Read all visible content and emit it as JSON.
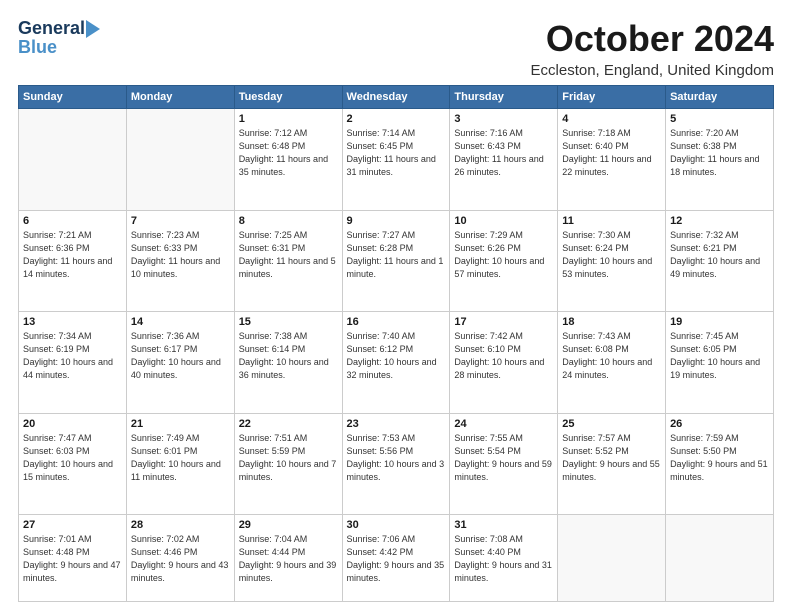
{
  "logo": {
    "line1": "General",
    "line2": "Blue"
  },
  "title": "October 2024",
  "subtitle": "Eccleston, England, United Kingdom",
  "weekdays": [
    "Sunday",
    "Monday",
    "Tuesday",
    "Wednesday",
    "Thursday",
    "Friday",
    "Saturday"
  ],
  "weeks": [
    [
      {
        "day": "",
        "info": ""
      },
      {
        "day": "",
        "info": ""
      },
      {
        "day": "1",
        "info": "Sunrise: 7:12 AM\nSunset: 6:48 PM\nDaylight: 11 hours and 35 minutes."
      },
      {
        "day": "2",
        "info": "Sunrise: 7:14 AM\nSunset: 6:45 PM\nDaylight: 11 hours and 31 minutes."
      },
      {
        "day": "3",
        "info": "Sunrise: 7:16 AM\nSunset: 6:43 PM\nDaylight: 11 hours and 26 minutes."
      },
      {
        "day": "4",
        "info": "Sunrise: 7:18 AM\nSunset: 6:40 PM\nDaylight: 11 hours and 22 minutes."
      },
      {
        "day": "5",
        "info": "Sunrise: 7:20 AM\nSunset: 6:38 PM\nDaylight: 11 hours and 18 minutes."
      }
    ],
    [
      {
        "day": "6",
        "info": "Sunrise: 7:21 AM\nSunset: 6:36 PM\nDaylight: 11 hours and 14 minutes."
      },
      {
        "day": "7",
        "info": "Sunrise: 7:23 AM\nSunset: 6:33 PM\nDaylight: 11 hours and 10 minutes."
      },
      {
        "day": "8",
        "info": "Sunrise: 7:25 AM\nSunset: 6:31 PM\nDaylight: 11 hours and 5 minutes."
      },
      {
        "day": "9",
        "info": "Sunrise: 7:27 AM\nSunset: 6:28 PM\nDaylight: 11 hours and 1 minute."
      },
      {
        "day": "10",
        "info": "Sunrise: 7:29 AM\nSunset: 6:26 PM\nDaylight: 10 hours and 57 minutes."
      },
      {
        "day": "11",
        "info": "Sunrise: 7:30 AM\nSunset: 6:24 PM\nDaylight: 10 hours and 53 minutes."
      },
      {
        "day": "12",
        "info": "Sunrise: 7:32 AM\nSunset: 6:21 PM\nDaylight: 10 hours and 49 minutes."
      }
    ],
    [
      {
        "day": "13",
        "info": "Sunrise: 7:34 AM\nSunset: 6:19 PM\nDaylight: 10 hours and 44 minutes."
      },
      {
        "day": "14",
        "info": "Sunrise: 7:36 AM\nSunset: 6:17 PM\nDaylight: 10 hours and 40 minutes."
      },
      {
        "day": "15",
        "info": "Sunrise: 7:38 AM\nSunset: 6:14 PM\nDaylight: 10 hours and 36 minutes."
      },
      {
        "day": "16",
        "info": "Sunrise: 7:40 AM\nSunset: 6:12 PM\nDaylight: 10 hours and 32 minutes."
      },
      {
        "day": "17",
        "info": "Sunrise: 7:42 AM\nSunset: 6:10 PM\nDaylight: 10 hours and 28 minutes."
      },
      {
        "day": "18",
        "info": "Sunrise: 7:43 AM\nSunset: 6:08 PM\nDaylight: 10 hours and 24 minutes."
      },
      {
        "day": "19",
        "info": "Sunrise: 7:45 AM\nSunset: 6:05 PM\nDaylight: 10 hours and 19 minutes."
      }
    ],
    [
      {
        "day": "20",
        "info": "Sunrise: 7:47 AM\nSunset: 6:03 PM\nDaylight: 10 hours and 15 minutes."
      },
      {
        "day": "21",
        "info": "Sunrise: 7:49 AM\nSunset: 6:01 PM\nDaylight: 10 hours and 11 minutes."
      },
      {
        "day": "22",
        "info": "Sunrise: 7:51 AM\nSunset: 5:59 PM\nDaylight: 10 hours and 7 minutes."
      },
      {
        "day": "23",
        "info": "Sunrise: 7:53 AM\nSunset: 5:56 PM\nDaylight: 10 hours and 3 minutes."
      },
      {
        "day": "24",
        "info": "Sunrise: 7:55 AM\nSunset: 5:54 PM\nDaylight: 9 hours and 59 minutes."
      },
      {
        "day": "25",
        "info": "Sunrise: 7:57 AM\nSunset: 5:52 PM\nDaylight: 9 hours and 55 minutes."
      },
      {
        "day": "26",
        "info": "Sunrise: 7:59 AM\nSunset: 5:50 PM\nDaylight: 9 hours and 51 minutes."
      }
    ],
    [
      {
        "day": "27",
        "info": "Sunrise: 7:01 AM\nSunset: 4:48 PM\nDaylight: 9 hours and 47 minutes."
      },
      {
        "day": "28",
        "info": "Sunrise: 7:02 AM\nSunset: 4:46 PM\nDaylight: 9 hours and 43 minutes."
      },
      {
        "day": "29",
        "info": "Sunrise: 7:04 AM\nSunset: 4:44 PM\nDaylight: 9 hours and 39 minutes."
      },
      {
        "day": "30",
        "info": "Sunrise: 7:06 AM\nSunset: 4:42 PM\nDaylight: 9 hours and 35 minutes."
      },
      {
        "day": "31",
        "info": "Sunrise: 7:08 AM\nSunset: 4:40 PM\nDaylight: 9 hours and 31 minutes."
      },
      {
        "day": "",
        "info": ""
      },
      {
        "day": "",
        "info": ""
      }
    ]
  ]
}
